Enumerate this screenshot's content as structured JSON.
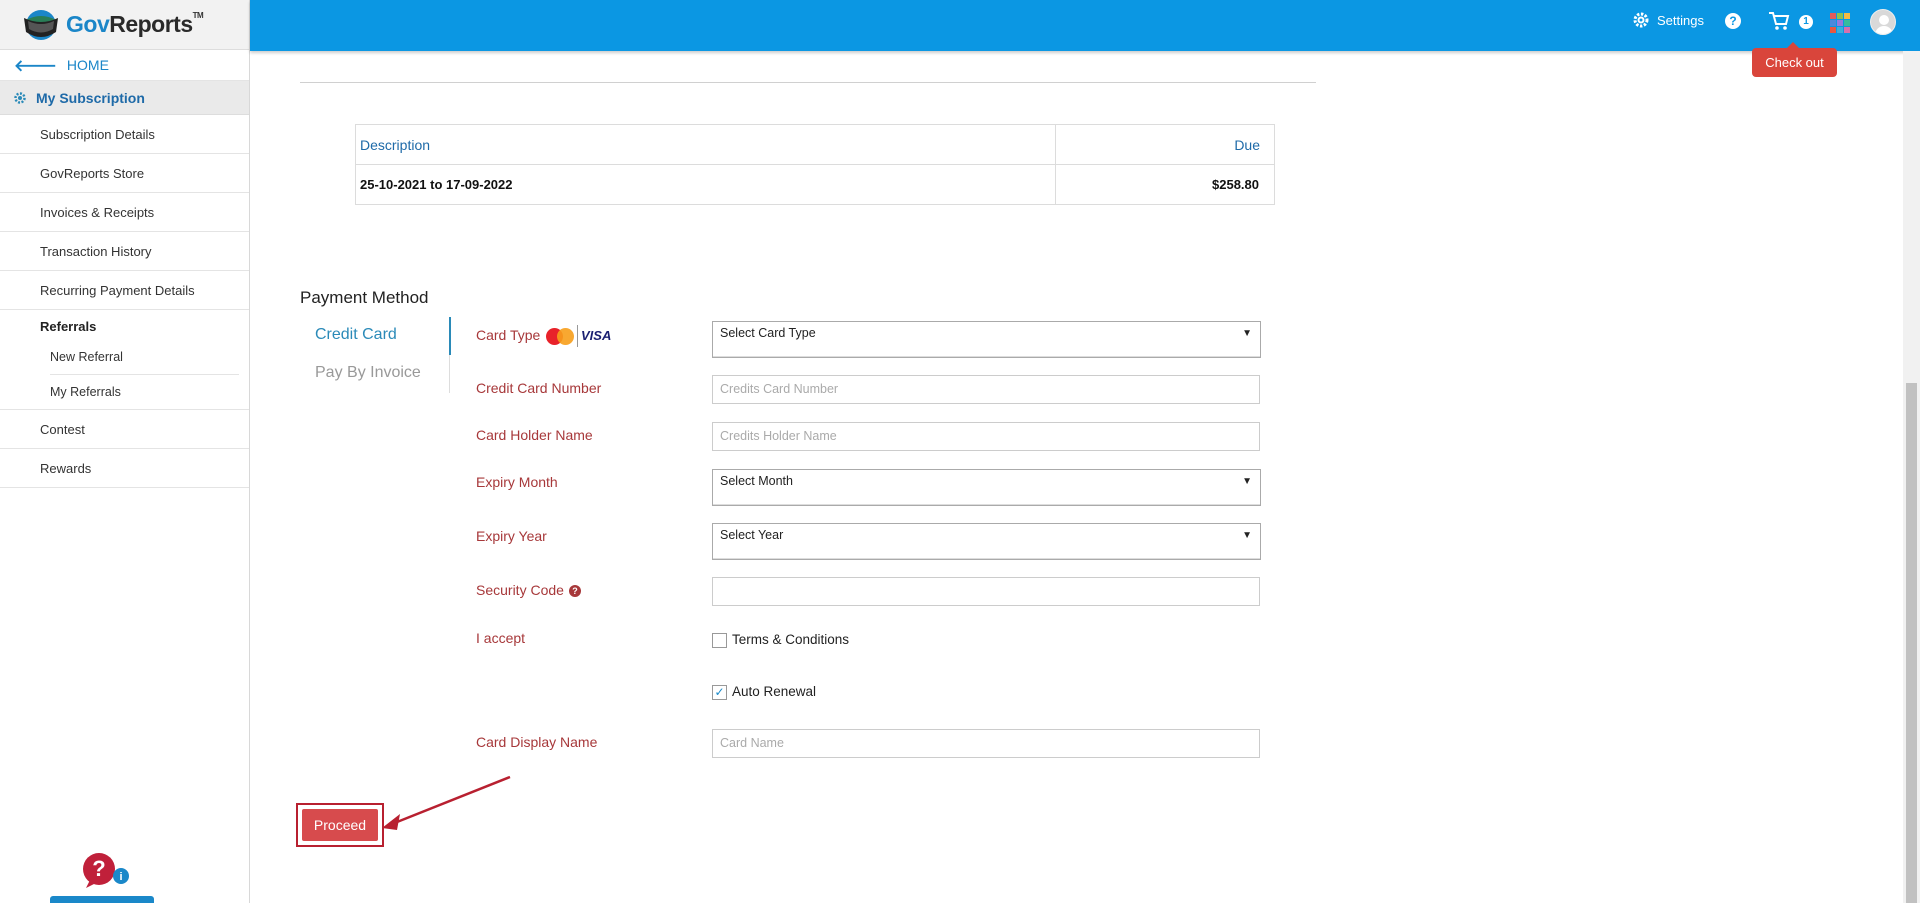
{
  "brand": {
    "gov": "Gov",
    "reports": "Reports",
    "tm": "TM"
  },
  "sidebar": {
    "home": "HOME",
    "section": "My Subscription",
    "items": [
      "Subscription Details",
      "GovReports Store",
      "Invoices & Receipts",
      "Transaction History",
      "Recurring Payment Details"
    ],
    "referrals": {
      "label": "Referrals",
      "children": [
        "New Referral",
        "My Referrals"
      ]
    },
    "items_after": [
      "Contest",
      "Rewards"
    ]
  },
  "topbar": {
    "settings": "Settings",
    "help": "?",
    "cart_count": "1",
    "checkout_tooltip": "Check out"
  },
  "invoice_table": {
    "headers": {
      "description": "Description",
      "due": "Due"
    },
    "rows": [
      {
        "description": "25-10-2021 to 17-09-2022",
        "due": "$258.80"
      }
    ]
  },
  "payment": {
    "title": "Payment Method",
    "tabs": {
      "credit_card": "Credit Card",
      "pay_by_invoice": "Pay By Invoice"
    },
    "labels": {
      "card_type": "Card Type",
      "card_number": "Credit Card Number",
      "holder_name": "Card Holder Name",
      "expiry_month": "Expiry Month",
      "expiry_year": "Expiry Year",
      "security_code": "Security Code",
      "i_accept": "I accept",
      "display_name": "Card Display Name"
    },
    "card_brands": {
      "visa": "VISA"
    },
    "fields": {
      "card_type": "Select Card Type",
      "card_number_placeholder": "Credits Card Number",
      "holder_name_placeholder": "Credits Holder Name",
      "expiry_month": "Select Month",
      "expiry_year": "Select Year",
      "security_code": "",
      "display_name_placeholder": "Card Name"
    },
    "terms_label": "Terms & Conditions",
    "terms_checked": false,
    "auto_renewal_label": "Auto Renewal",
    "auto_renewal_checked": true,
    "proceed": "Proceed"
  },
  "icons": {
    "back": "arrow-left-icon",
    "section": "gear-icon",
    "settings": "gear-icon",
    "help": "question-circle-icon",
    "cart": "cart-icon",
    "apps": "apps-grid-icon",
    "avatar": "user-avatar-icon",
    "security_help": "question-circle-icon",
    "support": "help-chat-icon"
  },
  "colors": {
    "topbar": "#0b97e3",
    "label_red": "#a7383a",
    "link_blue": "#1e6aa8",
    "proceed": "#d74b4d",
    "tooltip": "#d9453b"
  }
}
